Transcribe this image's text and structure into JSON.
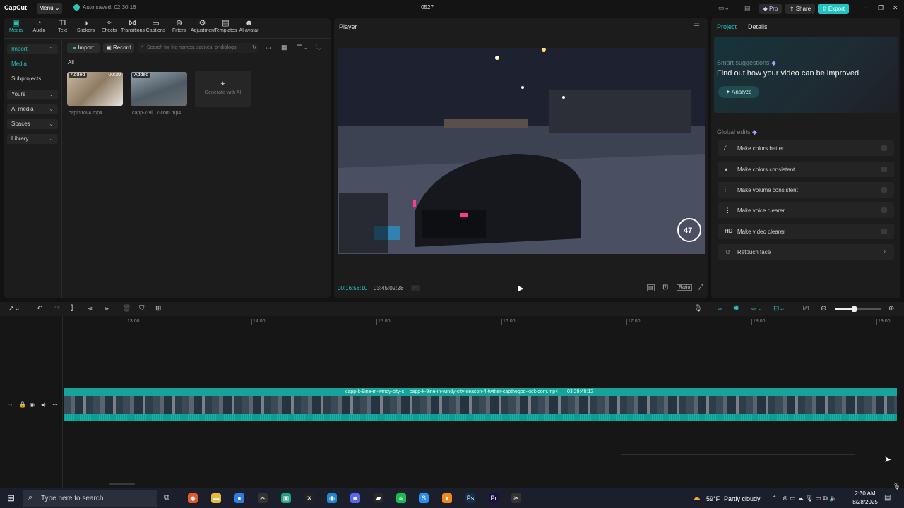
{
  "app": {
    "logo": "CapCut",
    "menu_label": "Menu",
    "autosave": "Auto saved: 02:30:16",
    "project_title": "0527",
    "pro_label": "Pro",
    "share_label": "Share",
    "export_label": "Export"
  },
  "tools": [
    {
      "label": "Media",
      "icon": "media-icon"
    },
    {
      "label": "Audio",
      "icon": "audio-icon"
    },
    {
      "label": "Text",
      "icon": "text-icon"
    },
    {
      "label": "Stickers",
      "icon": "stickers-icon"
    },
    {
      "label": "Effects",
      "icon": "effects-icon"
    },
    {
      "label": "Transitions",
      "icon": "transitions-icon"
    },
    {
      "label": "Captions",
      "icon": "captions-icon"
    },
    {
      "label": "Filters",
      "icon": "filters-icon"
    },
    {
      "label": "Adjustment",
      "icon": "adjustment-icon"
    },
    {
      "label": "Templates",
      "icon": "templates-icon"
    },
    {
      "label": "AI avatar",
      "icon": "ai-avatar-icon"
    }
  ],
  "sidebar": {
    "items": [
      {
        "label": "Import"
      },
      {
        "label": "Media"
      },
      {
        "label": "Subprojects"
      },
      {
        "label": "Yours"
      },
      {
        "label": "AI media"
      },
      {
        "label": "Spaces"
      },
      {
        "label": "Library"
      }
    ]
  },
  "media": {
    "import_label": "Import",
    "record_label": "Record",
    "search_placeholder": "Search for file names, scenes, or dialogs",
    "filter_label": "All",
    "files": [
      {
        "name": "capintrov4.mp4",
        "badge": "Added",
        "duration": "00:30"
      },
      {
        "name": "capp-k-9i...k-com.mp4",
        "badge": "Added",
        "duration": ""
      }
    ],
    "generate_label": "Generate with AI"
  },
  "player": {
    "title": "Player",
    "current_time": "00:16:58:10",
    "total_time": "03:45:02:28",
    "speed_readout": "47",
    "ratio_label": "Ratio"
  },
  "right_panel": {
    "tabs": [
      "Project",
      "Details"
    ],
    "smart_title": "Smart suggestions",
    "smart_heading": "Find out how your video can be improved",
    "analyze_label": "Analyze",
    "global_title": "Global edits",
    "edits": [
      {
        "label": "Make colors better",
        "icon": "magic-wand-icon"
      },
      {
        "label": "Make colors consistent",
        "icon": "palette-icon"
      },
      {
        "label": "Make volume consistent",
        "icon": "sliders-icon"
      },
      {
        "label": "Make voice clearer",
        "icon": "voice-icon"
      },
      {
        "label": "Make video clearer",
        "icon": "hd-icon",
        "glyph": "HD"
      },
      {
        "label": "Retouch face",
        "icon": "face-icon"
      }
    ]
  },
  "timeline": {
    "ruler": [
      "13:00",
      "14:00",
      "15:00",
      "16:00",
      "17:00",
      "18:00",
      "19:00"
    ],
    "clip_a": "capp-k-9ine-in-windy-city-s",
    "clip_b": "capp-k-9ine-in-windy-city-season-4-twitter-capthegod-kick-com.mp4",
    "clip_duration": "03:29:48:12"
  },
  "taskbar": {
    "search_placeholder": "Type here to search",
    "weather_temp": "59°F",
    "weather_text": "Partly cloudy",
    "time": "2:30 AM",
    "date": "8/28/2025"
  }
}
